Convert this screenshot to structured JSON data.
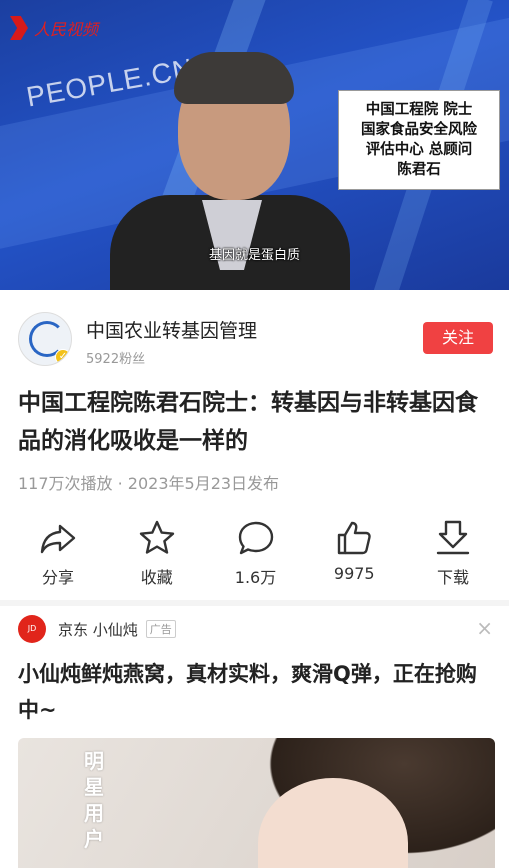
{
  "video": {
    "logo_text": "人民视频",
    "watermark": "PEOPLE.CN",
    "caption_lines": [
      "中国工程院 院士",
      "国家食品安全风险",
      "评估中心 总顾问",
      "陈君石"
    ],
    "subtitle": "基因就是蛋白质"
  },
  "account": {
    "name": "中国农业转基因管理",
    "fans": "5922粉丝",
    "follow_label": "关注",
    "avatar_icon": "dna-helix-icon",
    "verified_icon": "verified-badge-icon"
  },
  "post": {
    "title": "中国工程院陈君石院士：转基因与非转基因食品的消化吸收是一样的",
    "meta": "117万次播放 · 2023年5月23日发布"
  },
  "actions": [
    {
      "icon": "share-icon",
      "label": "分享"
    },
    {
      "icon": "star-icon",
      "label": "收藏"
    },
    {
      "icon": "comment-icon",
      "label": "1.6万"
    },
    {
      "icon": "thumbs-up-icon",
      "label": "9975"
    },
    {
      "icon": "download-icon",
      "label": "下载"
    }
  ],
  "ad": {
    "advertiser": "京东  小仙炖",
    "tag": "广告",
    "title": "小仙炖鲜炖燕窝，真材实料，爽滑Q弹，正在抢购中~",
    "image_vertical_text": [
      "明",
      "星",
      "用",
      "户"
    ]
  },
  "colors": {
    "accent": "#f04142",
    "video_bg": "#2454c9"
  }
}
